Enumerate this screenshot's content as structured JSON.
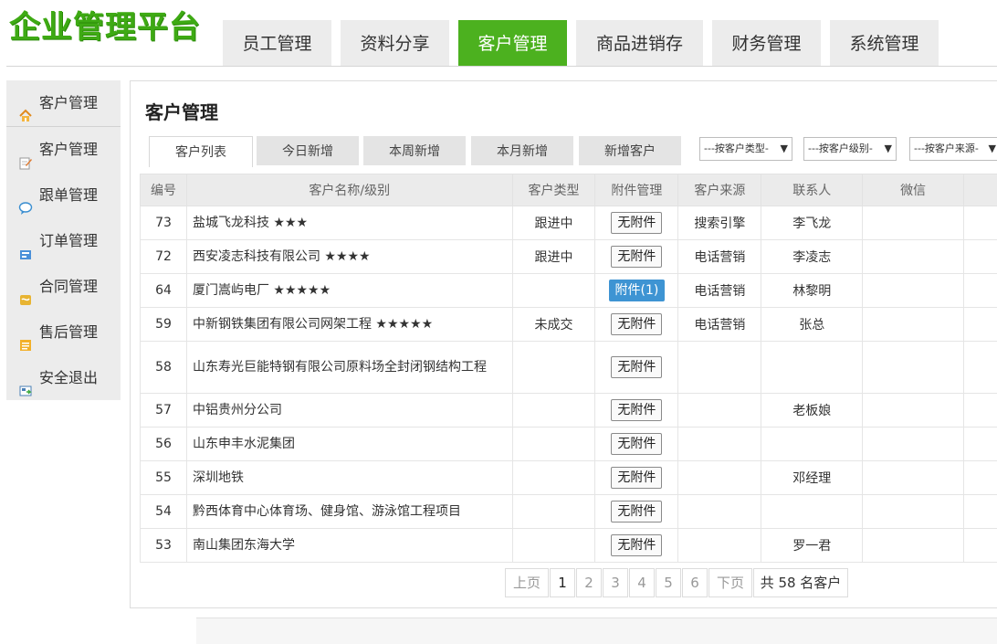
{
  "app": {
    "logo": "企业管理平台"
  },
  "topnav": [
    {
      "label": "员工管理",
      "active": false
    },
    {
      "label": "资料分享",
      "active": false
    },
    {
      "label": "客户管理",
      "active": true
    },
    {
      "label": "商品进销存",
      "active": false
    },
    {
      "label": "财务管理",
      "active": false
    },
    {
      "label": "系统管理",
      "active": false
    }
  ],
  "sidebar": {
    "items": [
      {
        "label": "客户管理",
        "icon": "home-icon"
      },
      {
        "label": "客户管理",
        "icon": "edit-icon"
      },
      {
        "label": "跟单管理",
        "icon": "chat-icon"
      },
      {
        "label": "订单管理",
        "icon": "order-icon"
      },
      {
        "label": "合同管理",
        "icon": "contract-icon"
      },
      {
        "label": "售后管理",
        "icon": "service-icon"
      },
      {
        "label": "安全退出",
        "icon": "logout-icon"
      }
    ]
  },
  "main": {
    "title": "客户管理",
    "tabs": [
      "客户列表",
      "今日新增",
      "本周新增",
      "本月新增",
      "新增客户"
    ],
    "filters": {
      "type": "---按客户类型-",
      "level": "---按客户级别-",
      "source": "---按客户来源-"
    }
  },
  "table": {
    "columns": [
      "编号",
      "客户名称/级别",
      "客户类型",
      "附件管理",
      "客户来源",
      "联系人",
      "微信"
    ],
    "rows": [
      {
        "id": "73",
        "name": "盐城飞龙科技 ★★★",
        "type": "跟进中",
        "attach": "无附件",
        "has_attach": false,
        "source": "搜索引擎",
        "contact": "李飞龙",
        "wechat": ""
      },
      {
        "id": "72",
        "name": "西安凌志科技有限公司 ★★★★",
        "type": "跟进中",
        "attach": "无附件",
        "has_attach": false,
        "source": "电话营销",
        "contact": "李凌志",
        "wechat": ""
      },
      {
        "id": "64",
        "name": "厦门嵩屿电厂 ★★★★★",
        "type": "",
        "attach": "附件(1)",
        "has_attach": true,
        "source": "电话营销",
        "contact": "林黎明",
        "wechat": ""
      },
      {
        "id": "59",
        "name": "中新钢铁集团有限公司网架工程 ★★★★★",
        "type": "未成交",
        "attach": "无附件",
        "has_attach": false,
        "source": "电话营销",
        "contact": "张总",
        "wechat": ""
      },
      {
        "id": "58",
        "name": "山东寿光巨能特钢有限公司原料场全封闭钢结构工程",
        "type": "",
        "attach": "无附件",
        "has_attach": false,
        "source": "",
        "contact": "",
        "wechat": ""
      },
      {
        "id": "57",
        "name": "中铝贵州分公司",
        "type": "",
        "attach": "无附件",
        "has_attach": false,
        "source": "",
        "contact": "老板娘",
        "wechat": ""
      },
      {
        "id": "56",
        "name": "山东申丰水泥集团",
        "type": "",
        "attach": "无附件",
        "has_attach": false,
        "source": "",
        "contact": "",
        "wechat": ""
      },
      {
        "id": "55",
        "name": "深圳地铁",
        "type": "",
        "attach": "无附件",
        "has_attach": false,
        "source": "",
        "contact": "邓经理",
        "wechat": ""
      },
      {
        "id": "54",
        "name": "黔西体育中心体育场、健身馆、游泳馆工程项目",
        "type": "",
        "attach": "无附件",
        "has_attach": false,
        "source": "",
        "contact": "",
        "wechat": ""
      },
      {
        "id": "53",
        "name": "南山集团东海大学",
        "type": "",
        "attach": "无附件",
        "has_attach": false,
        "source": "",
        "contact": "罗一君",
        "wechat": ""
      }
    ]
  },
  "pagination": {
    "prev": "上页",
    "pages": [
      "1",
      "2",
      "3",
      "4",
      "5",
      "6"
    ],
    "current": "1",
    "next": "下页",
    "total": "共 58 名客户"
  },
  "colors": {
    "brand": "#4cb11f",
    "attach_active": "#3e94d3"
  }
}
